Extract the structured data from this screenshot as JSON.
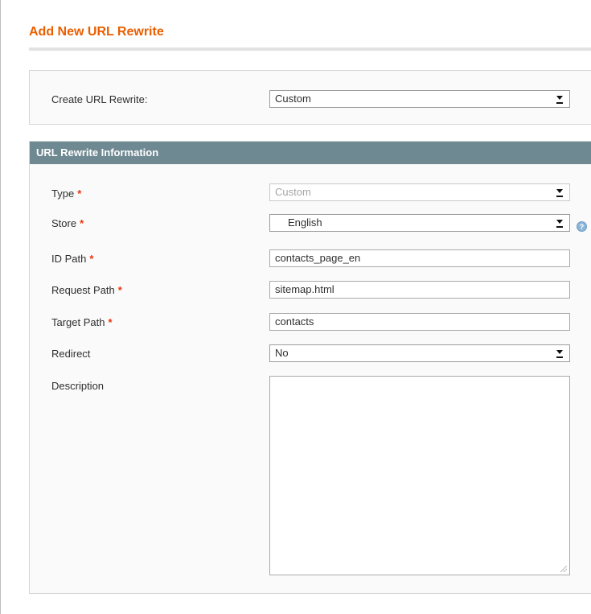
{
  "page": {
    "title": "Add New URL Rewrite"
  },
  "create_rewrite": {
    "label": "Create URL Rewrite:",
    "value": "Custom"
  },
  "section": {
    "title": "URL Rewrite Information"
  },
  "fields": {
    "type": {
      "label": "Type",
      "value": "Custom",
      "required": "*"
    },
    "store": {
      "label": "Store",
      "value": "English",
      "required": "*"
    },
    "id_path": {
      "label": "ID Path",
      "value": "contacts_page_en",
      "required": "*"
    },
    "request_path": {
      "label": "Request Path",
      "value": "sitemap.html",
      "required": "*"
    },
    "target_path": {
      "label": "Target Path",
      "value": "contacts",
      "required": "*"
    },
    "redirect": {
      "label": "Redirect",
      "value": "No"
    },
    "description": {
      "label": "Description",
      "value": ""
    }
  },
  "icons": {
    "select_arrow": "dropdown-arrow-icon",
    "store_help": "help-icon",
    "resize": "resize-grip-icon"
  },
  "colors": {
    "title": "#eb5e00",
    "section_header": "#6f8992",
    "required": "#eb340a"
  }
}
